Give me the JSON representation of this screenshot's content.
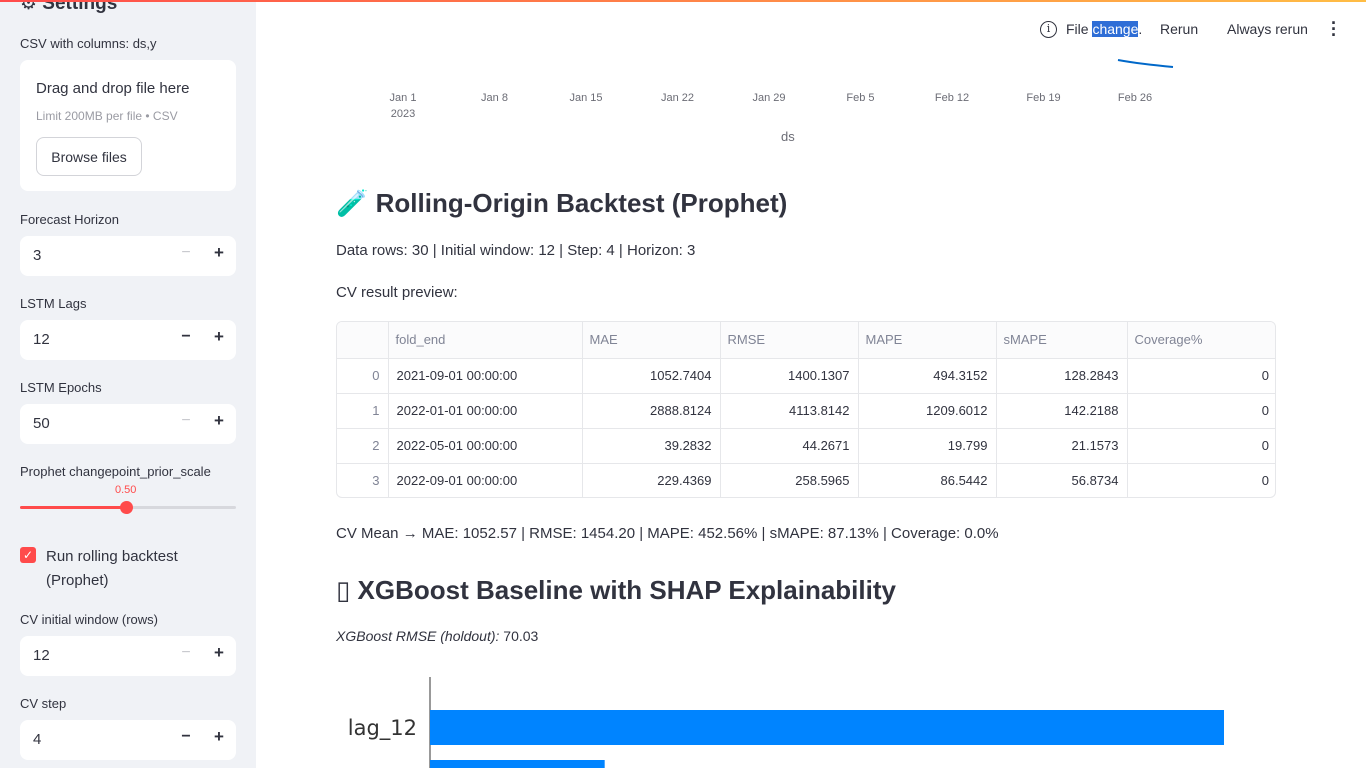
{
  "sidebar": {
    "title": "⚙ Settings",
    "csv_label": "CSV with columns: ds,y",
    "uploader": {
      "title": "Drag and drop file here",
      "limit": "Limit 200MB per file • CSV",
      "browse": "Browse files"
    },
    "forecast_horizon": {
      "label": "Forecast Horizon",
      "value": "3"
    },
    "lstm_lags": {
      "label": "LSTM Lags",
      "value": "12"
    },
    "lstm_epochs": {
      "label": "LSTM Epochs",
      "value": "50"
    },
    "prophet_cps": {
      "label": "Prophet changepoint_prior_scale",
      "value": "0.50",
      "fraction": 0.49
    },
    "run_backtest": {
      "label": "Run rolling backtest (Prophet)",
      "checked": true
    },
    "cv_initial": {
      "label": "CV initial window (rows)",
      "value": "12"
    },
    "cv_step": {
      "label": "CV step",
      "value": "4"
    }
  },
  "toolbar": {
    "file_prefix": "File",
    "file_selected": "change",
    "file_suffix": ".",
    "rerun": "Rerun",
    "always_rerun": "Always rerun"
  },
  "top_chart": {
    "ticks": [
      "Jan 1",
      "Jan 8",
      "Jan 15",
      "Jan 22",
      "Jan 29",
      "Feb 5",
      "Feb 12",
      "Feb 19",
      "Feb 26"
    ],
    "year": "2023",
    "xlabel": "ds",
    "line_color": "#0068c9"
  },
  "backtest": {
    "heading_icon": "🧪",
    "heading": "Rolling-Origin Backtest (Prophet)",
    "summary": "Data rows: 30 | Initial window: 12 | Step: 4 | Horizon: 3",
    "preview_label": "CV result preview:",
    "columns": [
      "",
      "fold_end",
      "MAE",
      "RMSE",
      "MAPE",
      "sMAPE",
      "Coverage%"
    ],
    "rows": [
      [
        "0",
        "2021-09-01 00:00:00",
        "1052.7404",
        "1400.1307",
        "494.3152",
        "128.2843",
        "0"
      ],
      [
        "1",
        "2022-01-01 00:00:00",
        "2888.8124",
        "4113.8142",
        "1209.6012",
        "142.2188",
        "0"
      ],
      [
        "2",
        "2022-05-01 00:00:00",
        "39.2832",
        "44.2671",
        "19.799",
        "21.1573",
        "0"
      ],
      [
        "3",
        "2022-09-01 00:00:00",
        "229.4369",
        "258.5965",
        "86.5442",
        "56.8734",
        "0"
      ]
    ],
    "cv_mean": "CV Mean → MAE: 1052.57 | RMSE: 1454.20 | MAPE: 452.56% | sMAPE: 87.13% | Coverage: 0.0%"
  },
  "xgboost": {
    "heading_icon": "▯",
    "heading": "XGBoost Baseline with SHAP Explainability",
    "rmse_label": "XGBoost RMSE (holdout):",
    "rmse_value": "70.03"
  },
  "chart_data": {
    "type": "bar",
    "categories": [
      "lag_12",
      ""
    ],
    "values": [
      1.0,
      0.22
    ],
    "bar_color": "#0084ff"
  }
}
